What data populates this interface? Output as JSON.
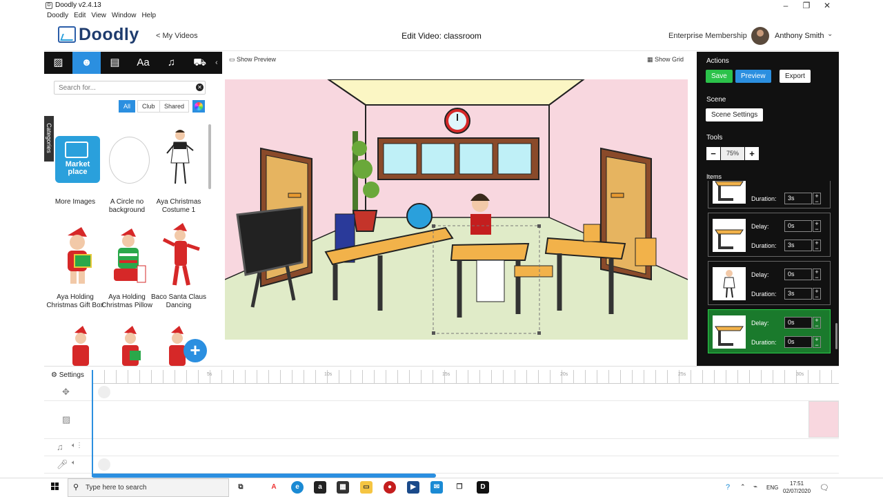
{
  "window": {
    "title": "Doodly v2.4.13"
  },
  "menu": [
    "Doodly",
    "Edit",
    "View",
    "Window",
    "Help"
  ],
  "header": {
    "logo": "Doodly",
    "back_link": "< My Videos",
    "video_title": "Edit Video: classroom",
    "membership": "Enterprise Membership",
    "username": "Anthony Smith"
  },
  "left_panel": {
    "search_placeholder": "Search for...",
    "filters": [
      "All",
      "Club",
      "Shared"
    ],
    "categories_tab": "Categories",
    "assets": [
      {
        "label": "More Images",
        "logo_text": "Market place"
      },
      {
        "label": "A Circle no background"
      },
      {
        "label": "Aya Christmas Costume 1"
      },
      {
        "label": "Aya Holding Christmas Gift Box"
      },
      {
        "label": "Aya Holding Christmas Pillow"
      },
      {
        "label": "Baco Santa Claus Dancing"
      }
    ]
  },
  "canvas": {
    "show_preview": "Show Preview",
    "show_grid": "Show Grid"
  },
  "right_panel": {
    "actions_title": "Actions",
    "save": "Save",
    "preview": "Preview",
    "export": "Export",
    "scene_title": "Scene",
    "scene_settings": "Scene Settings",
    "tools_title": "Tools",
    "zoom": "75%",
    "items_title": "Items",
    "items": [
      {
        "delay": "",
        "duration": "3s"
      },
      {
        "delay": "0s",
        "duration": "3s"
      },
      {
        "delay": "0s",
        "duration": "3s"
      },
      {
        "delay": "0s",
        "duration": "0s"
      }
    ],
    "delay_label": "Delay:",
    "duration_label": "Duration:"
  },
  "timeline": {
    "settings": "Settings",
    "ticks": [
      "5s",
      "10s",
      "15s",
      "20s",
      "25s",
      "30s"
    ]
  },
  "taskbar": {
    "search_placeholder": "Type here to search",
    "language": "ENG",
    "time": "17:51",
    "date": "02/07/2020"
  }
}
